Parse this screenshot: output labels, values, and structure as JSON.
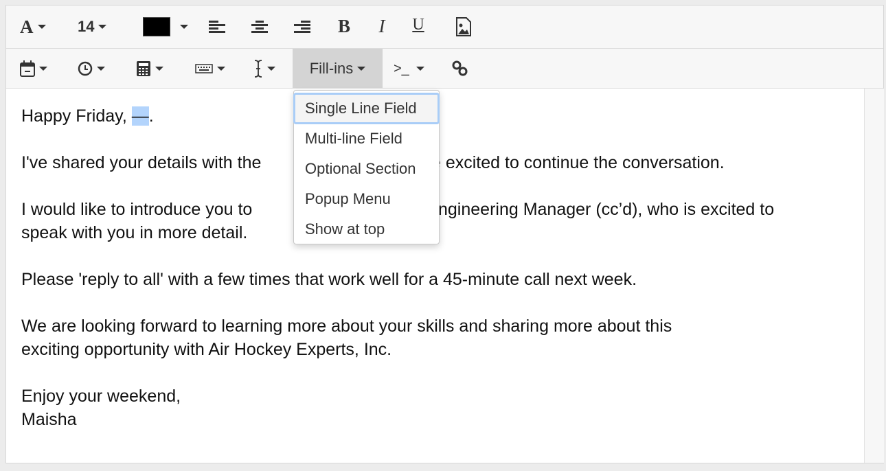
{
  "toolbar_row1": {
    "font_icon": "A",
    "font_size": "14",
    "text_color": "#000000",
    "bold": "B",
    "italic": "I",
    "underline": "U"
  },
  "toolbar_row2": {
    "fillins_label": "Fill-ins",
    "shell_label": ">_"
  },
  "fillins_menu": {
    "items": [
      "Single Line Field",
      "Multi-line Field",
      "Optional Section",
      "Popup Menu",
      "Show at top"
    ],
    "highlighted": "Single Line Field"
  },
  "editor": {
    "greeting_before": "Happy Friday, ",
    "greeting_field": "—",
    "greeting_after": ".",
    "p2_left": "I've shared your details with the",
    "p2_right": "e excited to continue the conversation.",
    "p3_l1_left": "I would like to introduce you to",
    "p3_l1_right": "ngineering Manager (cc’d), who is excited to",
    "p3_l2": "speak with you in more detail.",
    "p4": "Please 'reply to all' with a few times that work well for a 45-minute call next week.",
    "p5_l1": "We are looking forward to learning more about your skills and sharing more about this",
    "p5_l2": "exciting opportunity with Air Hockey Experts, Inc.",
    "closing": "Enjoy your weekend,",
    "signature": "Maisha"
  },
  "colors": {
    "highlight": "#b3d4fc",
    "active_button": "#d4d4d4",
    "focus_ring": "#a9cdf7"
  }
}
